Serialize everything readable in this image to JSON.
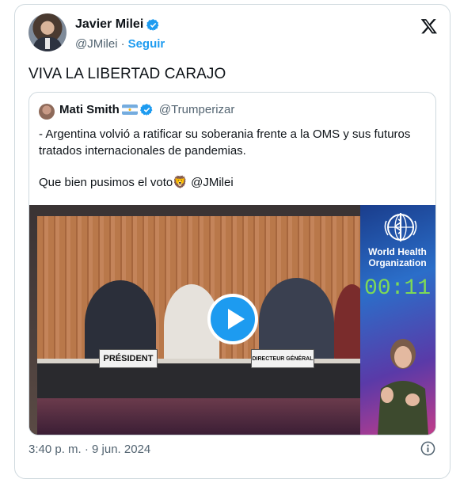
{
  "tweet": {
    "author_name": "Javier Milei",
    "handle": "@JMilei",
    "separator": "·",
    "follow_label": "Seguir",
    "text": "VIVA LA LIBERTAD CARAJO",
    "timestamp": "3:40 p. m. · 9 jun. 2024"
  },
  "quote": {
    "author_name": "Mati Smith",
    "handle": "@Trumperizar",
    "line1": "- Argentina volvió a ratificar su soberania frente a la OMS y sus futuros tratados internacionales de pandemias.",
    "line2_text": "Que bien pusimos el voto",
    "line2_emoji": "🦁",
    "line2_mention": "@JMilei"
  },
  "video": {
    "org_line1": "World Health",
    "org_line2": "Organization",
    "timer": "00:11",
    "plaque_left": "PRÉSIDENT",
    "plaque_right": "DIRECTEUR GÉNÉRAL"
  },
  "colors": {
    "accent": "#1d9bf0",
    "text_secondary": "#536471",
    "border": "#cfd9de"
  },
  "icons": [
    "verified-badge-icon",
    "x-logo-icon",
    "argentina-flag-icon",
    "play-icon",
    "info-icon",
    "who-emblem-icon"
  ]
}
